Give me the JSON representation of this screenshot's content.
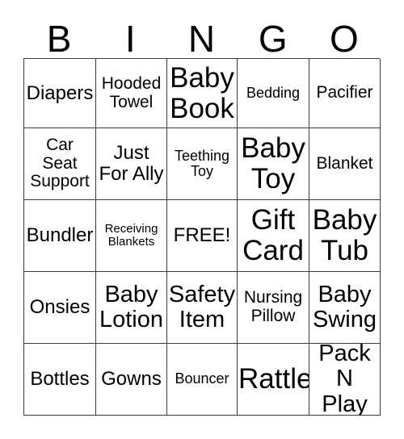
{
  "card": {
    "title": "BINGO",
    "header_letters": [
      "B",
      "I",
      "N",
      "G",
      "O"
    ],
    "grid_size": "5x5",
    "free_space": "FREE!",
    "columns": [
      {
        "letter": "B",
        "cells": [
          "Diapers",
          "Car\nSeat\nSupport",
          "Bundler",
          "Onsies",
          "Bottles"
        ]
      },
      {
        "letter": "I",
        "cells": [
          "Hooded\nTowel",
          "Just\nFor Ally",
          "Receiving\nBlankets",
          "Baby\nLotion",
          "Gowns"
        ]
      },
      {
        "letter": "N",
        "cells": [
          "Baby\nBook",
          "Teething\nToy",
          "FREE!",
          "Safety\nItem",
          "Bouncer"
        ]
      },
      {
        "letter": "G",
        "cells": [
          "Bedding",
          "Baby\nToy",
          "Gift\nCard",
          "Nursing\nPillow",
          "Rattle"
        ]
      },
      {
        "letter": "O",
        "cells": [
          "Pacifier",
          "Blanket",
          "Baby\nTub",
          "Baby\nSwing",
          "Pack\nN Play"
        ]
      }
    ],
    "rows": [
      [
        "Diapers",
        "Hooded\nTowel",
        "Baby\nBook",
        "Bedding",
        "Pacifier"
      ],
      [
        "Car\nSeat\nSupport",
        "Just\nFor Ally",
        "Teething\nToy",
        "Baby\nToy",
        "Blanket"
      ],
      [
        "Bundler",
        "Receiving\nBlankets",
        "FREE!",
        "Gift\nCard",
        "Baby\nTub"
      ],
      [
        "Onsies",
        "Baby\nLotion",
        "Safety\nItem",
        "Nursing\nPillow",
        "Baby\nSwing"
      ],
      [
        "Bottles",
        "Gowns",
        "Bouncer",
        "Rattle",
        "Pack\nN Play"
      ]
    ],
    "colors": {
      "background": "#ffffff",
      "text": "#000000",
      "border": "#3a3a3a"
    }
  }
}
